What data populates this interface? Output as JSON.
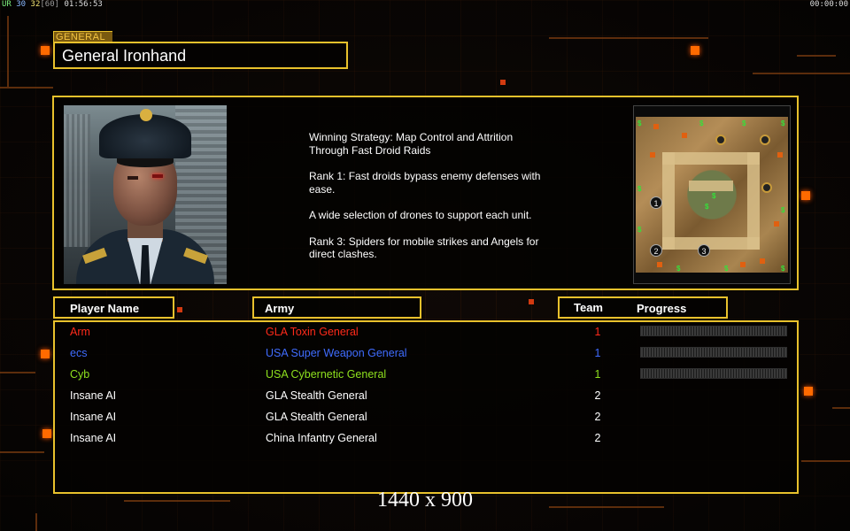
{
  "hud": {
    "left_parts": [
      {
        "text": "UR",
        "color": "g"
      },
      {
        "text": " 30 ",
        "color": "b"
      },
      {
        "text": "32",
        "color": "y"
      },
      {
        "text": "[60]",
        "color": "gr"
      },
      {
        "text": " 01:56:53",
        "color": ""
      }
    ],
    "right": "00:00:00"
  },
  "general": {
    "tag": "GENERAL",
    "name": "General Ironhand"
  },
  "strategy": [
    "Winning Strategy: Map Control and Attrition\n Through Fast Droid Raids",
    "Rank 1: Fast droids bypass enemy defenses with\n ease.",
    "A wide selection of drones to support each unit.",
    "Rank 3: Spiders for mobile strikes and Angels for\n direct clashes."
  ],
  "minimap": {
    "start_positions": [
      "1",
      "2",
      "3"
    ]
  },
  "headers": {
    "player_name": "Player Name",
    "army": "Army",
    "team": "Team",
    "progress": "Progress"
  },
  "players": [
    {
      "name": "Arm",
      "army": "GLA Toxin General",
      "team": "1",
      "color": "#ff2a1a",
      "progress_bar": true
    },
    {
      "name": "ecs",
      "army": "USA Super Weapon General",
      "team": "1",
      "color": "#3f6cff",
      "progress_bar": true
    },
    {
      "name": "Cyb",
      "army": "USA Cybernetic General",
      "team": "1",
      "color": "#8ee01e",
      "progress_bar": true
    },
    {
      "name": "Insane AI",
      "army": "GLA Stealth General",
      "team": "2",
      "color": "#ffffff",
      "progress_bar": false
    },
    {
      "name": "Insane AI",
      "army": "GLA Stealth General",
      "team": "2",
      "color": "#ffffff",
      "progress_bar": false
    },
    {
      "name": "Insane AI",
      "army": "China Infantry General",
      "team": "2",
      "color": "#ffffff",
      "progress_bar": false
    }
  ],
  "resolution_label": "1440 x 900",
  "colors": {
    "frame": "#e8c12c",
    "accent_orange": "#ff6a00"
  }
}
